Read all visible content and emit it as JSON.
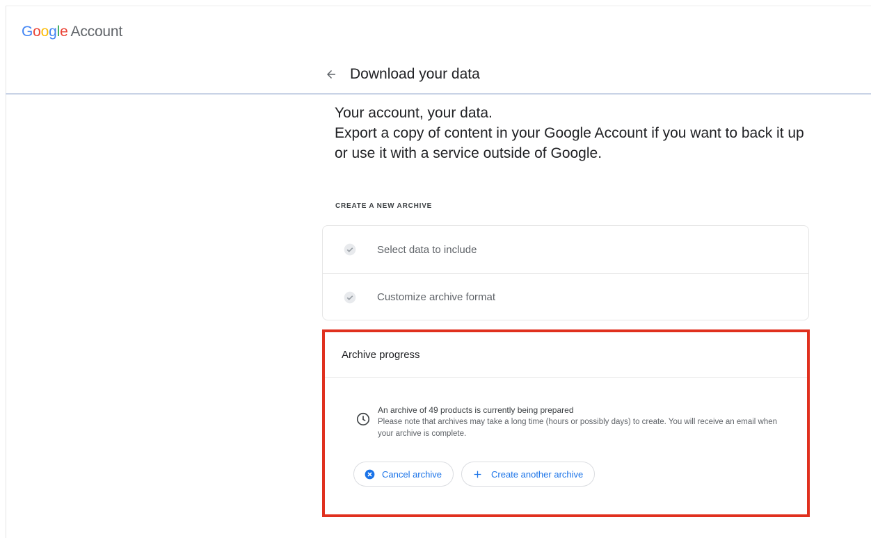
{
  "header": {
    "logo": {
      "g1": "G",
      "o1": "o",
      "o2": "o",
      "g2": "g",
      "l": "l",
      "e": "e",
      "account": "Account"
    },
    "page_title": "Download your data"
  },
  "intro": {
    "line1": "Your account, your data.",
    "line2": "Export a copy of content in your Google Account if you want to back it up or use it with a service outside of Google."
  },
  "section_label": "CREATE A NEW ARCHIVE",
  "steps": [
    {
      "label": "Select data to include",
      "icon": "check-circle-icon"
    },
    {
      "label": "Customize archive format",
      "icon": "check-circle-icon"
    }
  ],
  "progress": {
    "title": "Archive progress",
    "message": "An archive of 49 products is currently being prepared",
    "detail": "Please note that archives may take a long time (hours or possibly days) to create. You will receive an email when your archive is complete.",
    "cancel_label": "Cancel archive",
    "create_label": "Create another archive"
  },
  "colors": {
    "accent": "#1a73e8",
    "highlight_border": "#e0301e",
    "muted_text": "#5f6368"
  }
}
